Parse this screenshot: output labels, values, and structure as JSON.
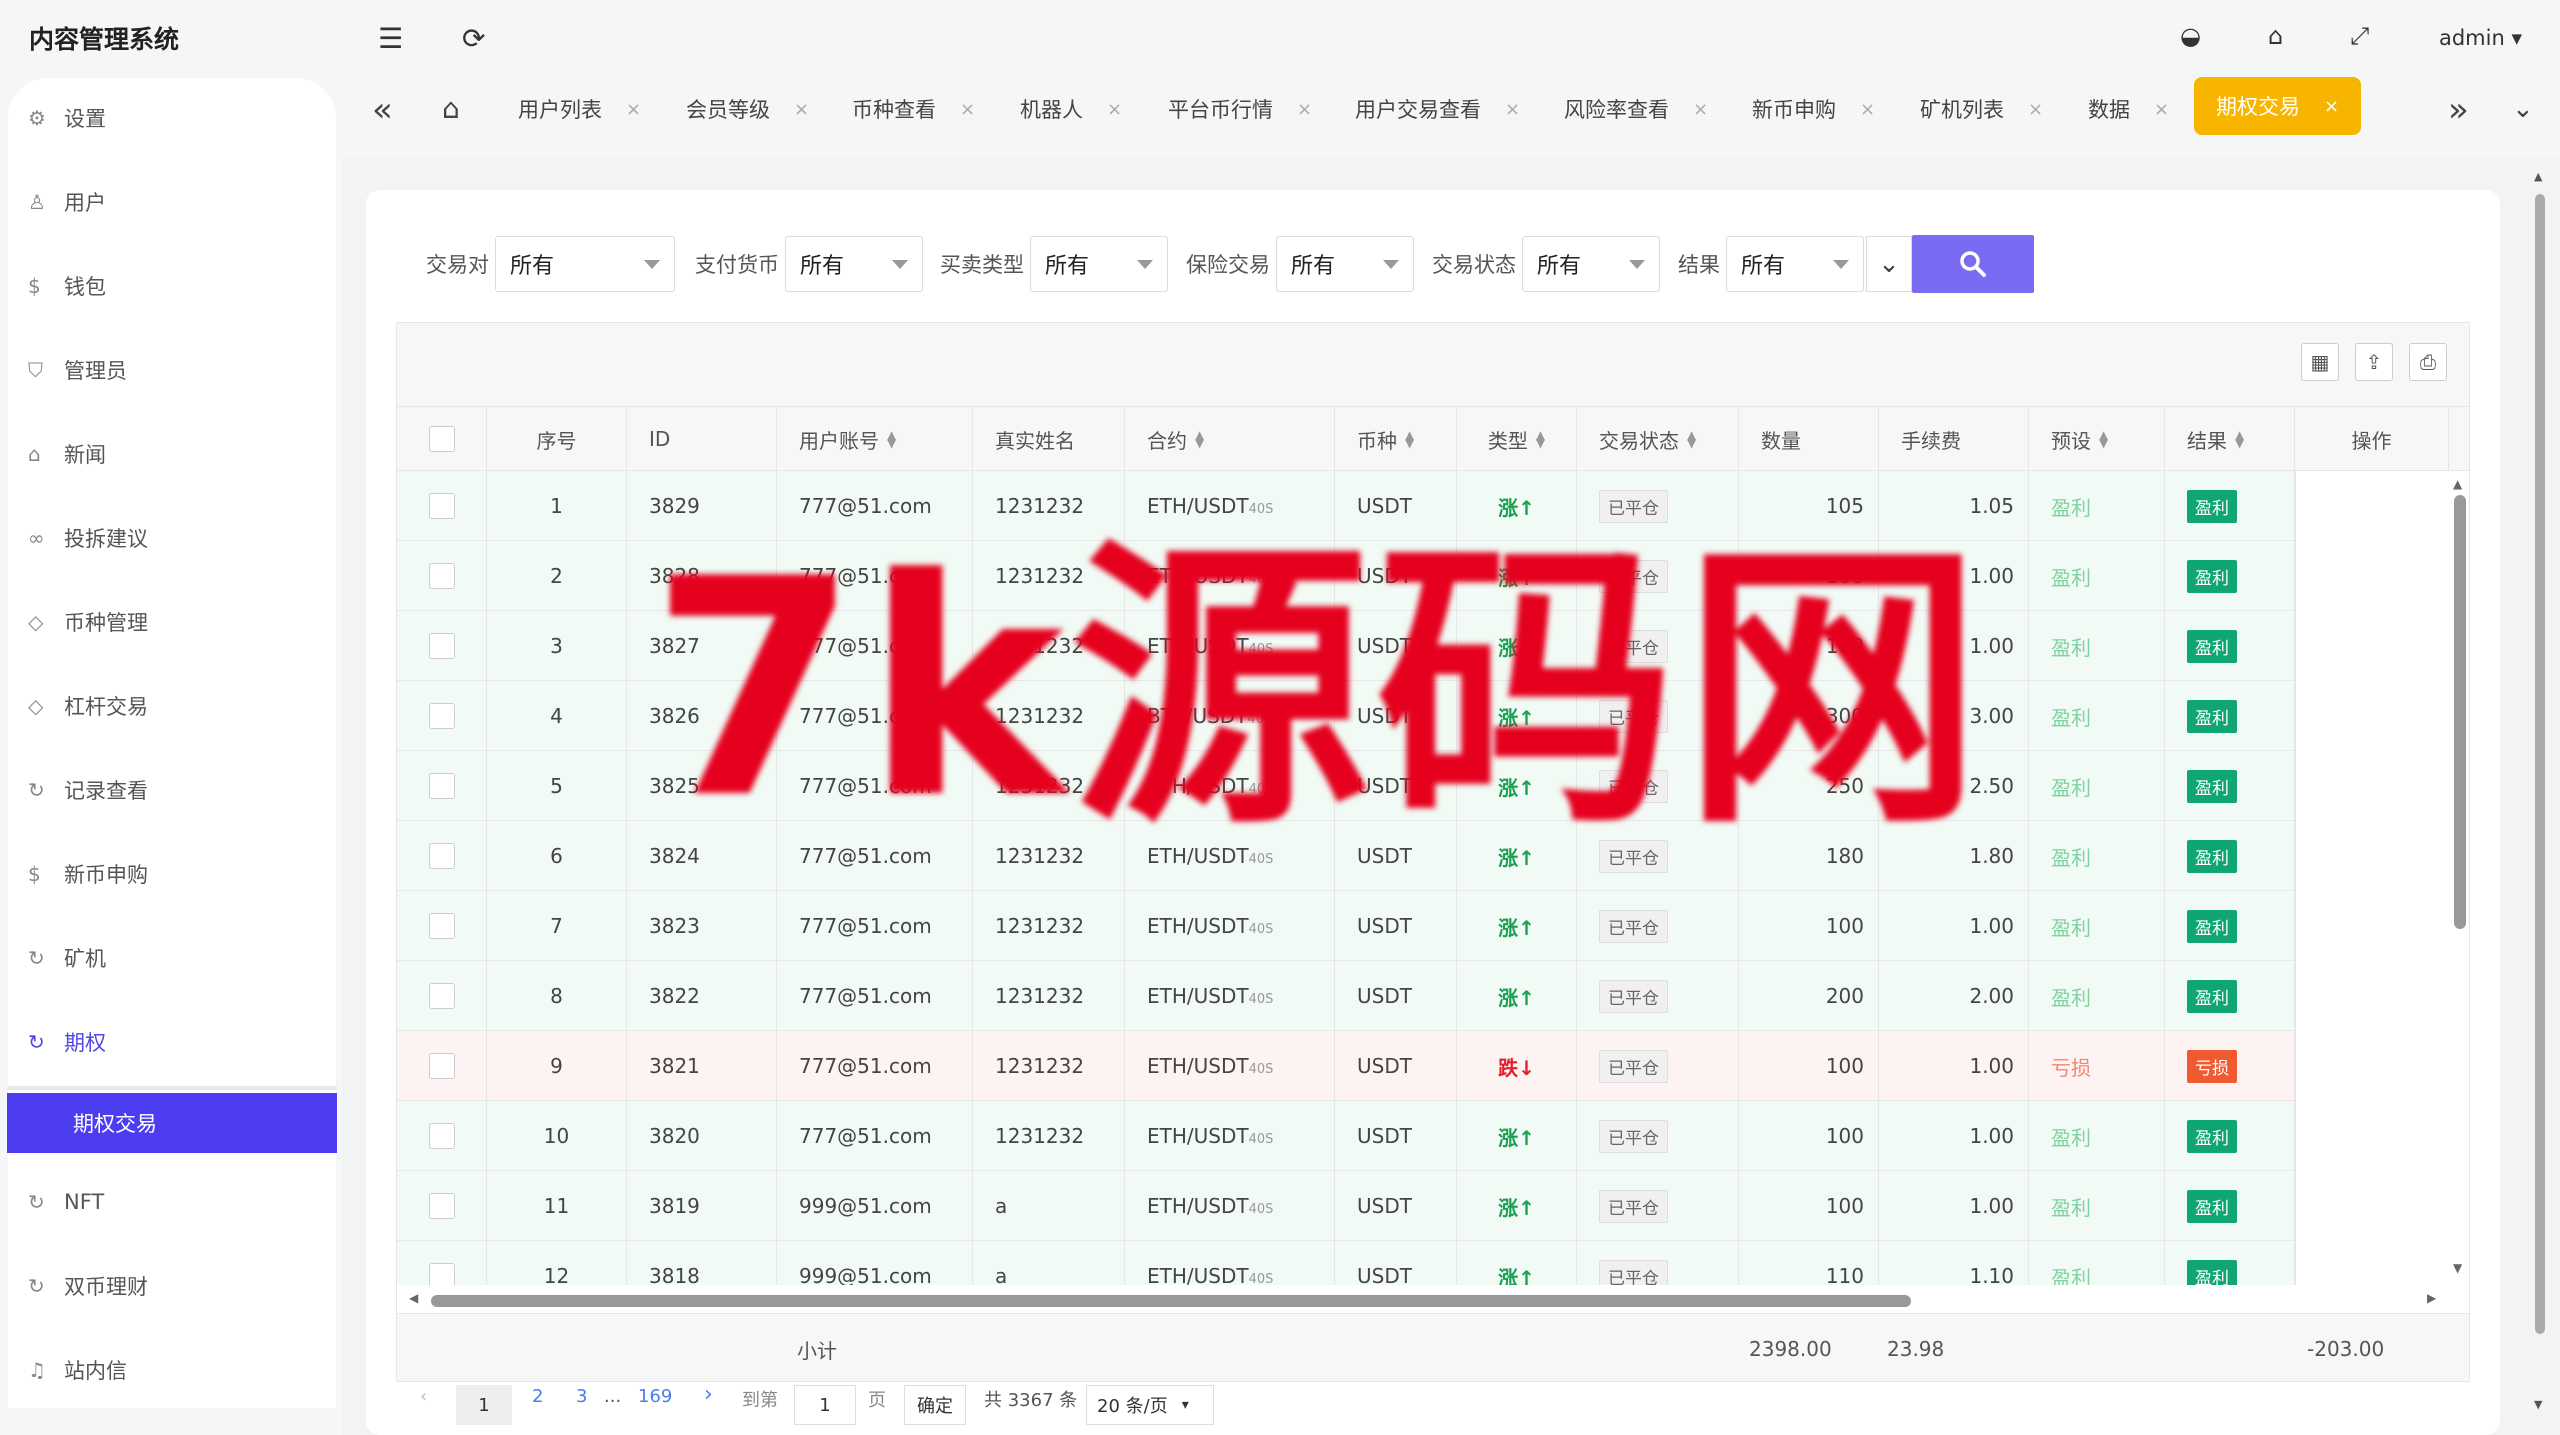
{
  "app": {
    "title": "内容管理系统",
    "user": "admin"
  },
  "sidebar": {
    "items": [
      {
        "label": "设置",
        "icon": "gear-icon"
      },
      {
        "label": "用户",
        "icon": "user-icon"
      },
      {
        "label": "钱包",
        "icon": "dollar-icon"
      },
      {
        "label": "管理员",
        "icon": "shield-icon"
      },
      {
        "label": "新闻",
        "icon": "tag-icon"
      },
      {
        "label": "投拆建议",
        "icon": "link-icon"
      },
      {
        "label": "币种管理",
        "icon": "diamond-icon"
      },
      {
        "label": "杠杆交易",
        "icon": "diamond-icon"
      },
      {
        "label": "记录查看",
        "icon": "circle-arrow-icon"
      },
      {
        "label": "新币申购",
        "icon": "dollar-icon"
      },
      {
        "label": "矿机",
        "icon": "circle-arrow-icon"
      },
      {
        "label": "期权",
        "icon": "circle-arrow-icon"
      },
      {
        "label": "NFT",
        "icon": "circle-arrow-icon"
      },
      {
        "label": "双币理财",
        "icon": "circle-arrow-icon"
      },
      {
        "label": "站内信",
        "icon": "bell-icon"
      }
    ],
    "active_sub": "期权交易"
  },
  "tabs": [
    "用户列表",
    "会员等级",
    "币种查看",
    "机器人",
    "平台币行情",
    "用户交易查看",
    "风险率查看",
    "新币申购",
    "矿机列表",
    "数据",
    "期权交易"
  ],
  "filters": [
    {
      "label": "交易对",
      "value": "所有"
    },
    {
      "label": "支付货币",
      "value": "所有"
    },
    {
      "label": "买卖类型",
      "value": "所有"
    },
    {
      "label": "保险交易",
      "value": "所有"
    },
    {
      "label": "交易状态",
      "value": "所有"
    },
    {
      "label": "结果",
      "value": "所有"
    }
  ],
  "table": {
    "headers": [
      "序号",
      "ID",
      "用户账号",
      "真实姓名",
      "合约",
      "币种",
      "类型",
      "交易状态",
      "数量",
      "手续费",
      "预设",
      "结果",
      "操作"
    ],
    "contract_suffix": "40S",
    "rows": [
      {
        "no": "1",
        "id": "3829",
        "account": "777@51.com",
        "name": "1231232",
        "contract": "ETH/USDT",
        "coin": "USDT",
        "type": "涨↑",
        "status": "已平仓",
        "qty": "105",
        "fee": "1.05",
        "preset": "盈利",
        "result": "盈利",
        "win": true
      },
      {
        "no": "2",
        "id": "3828",
        "account": "777@51.com",
        "name": "1231232",
        "contract": "ETH/USDT",
        "coin": "USDT",
        "type": "涨↑",
        "status": "已平仓",
        "qty": "100",
        "fee": "1.00",
        "preset": "盈利",
        "result": "盈利",
        "win": true
      },
      {
        "no": "3",
        "id": "3827",
        "account": "777@51.com",
        "name": "1231232",
        "contract": "ETH/USDT",
        "coin": "USDT",
        "type": "涨↑",
        "status": "已平仓",
        "qty": "100",
        "fee": "1.00",
        "preset": "盈利",
        "result": "盈利",
        "win": true
      },
      {
        "no": "4",
        "id": "3826",
        "account": "777@51.com",
        "name": "1231232",
        "contract": "BTC/USDT",
        "coin": "USDT",
        "type": "涨↑",
        "status": "已平仓",
        "qty": "300",
        "fee": "3.00",
        "preset": "盈利",
        "result": "盈利",
        "win": true
      },
      {
        "no": "5",
        "id": "3825",
        "account": "777@51.com",
        "name": "1231232",
        "contract": "ETH/USDT",
        "coin": "USDT",
        "type": "涨↑",
        "status": "已平仓",
        "qty": "250",
        "fee": "2.50",
        "preset": "盈利",
        "result": "盈利",
        "win": true
      },
      {
        "no": "6",
        "id": "3824",
        "account": "777@51.com",
        "name": "1231232",
        "contract": "ETH/USDT",
        "coin": "USDT",
        "type": "涨↑",
        "status": "已平仓",
        "qty": "180",
        "fee": "1.80",
        "preset": "盈利",
        "result": "盈利",
        "win": true
      },
      {
        "no": "7",
        "id": "3823",
        "account": "777@51.com",
        "name": "1231232",
        "contract": "ETH/USDT",
        "coin": "USDT",
        "type": "涨↑",
        "status": "已平仓",
        "qty": "100",
        "fee": "1.00",
        "preset": "盈利",
        "result": "盈利",
        "win": true
      },
      {
        "no": "8",
        "id": "3822",
        "account": "777@51.com",
        "name": "1231232",
        "contract": "ETH/USDT",
        "coin": "USDT",
        "type": "涨↑",
        "status": "已平仓",
        "qty": "200",
        "fee": "2.00",
        "preset": "盈利",
        "result": "盈利",
        "win": true
      },
      {
        "no": "9",
        "id": "3821",
        "account": "777@51.com",
        "name": "1231232",
        "contract": "ETH/USDT",
        "coin": "USDT",
        "type": "跌↓",
        "status": "已平仓",
        "qty": "100",
        "fee": "1.00",
        "preset": "亏损",
        "result": "亏损",
        "win": false
      },
      {
        "no": "10",
        "id": "3820",
        "account": "777@51.com",
        "name": "1231232",
        "contract": "ETH/USDT",
        "coin": "USDT",
        "type": "涨↑",
        "status": "已平仓",
        "qty": "100",
        "fee": "1.00",
        "preset": "盈利",
        "result": "盈利",
        "win": true
      },
      {
        "no": "11",
        "id": "3819",
        "account": "999@51.com",
        "name": "a",
        "contract": "ETH/USDT",
        "coin": "USDT",
        "type": "涨↑",
        "status": "已平仓",
        "qty": "100",
        "fee": "1.00",
        "preset": "盈利",
        "result": "盈利",
        "win": true
      },
      {
        "no": "12",
        "id": "3818",
        "account": "999@51.com",
        "name": "a",
        "contract": "ETH/USDT",
        "coin": "USDT",
        "type": "涨↑",
        "status": "已平仓",
        "qty": "110",
        "fee": "1.10",
        "preset": "盈利",
        "result": "盈利",
        "win": true
      }
    ],
    "footer": {
      "label": "小计",
      "qty_total": "2398.00",
      "fee_total": "23.98",
      "result_total": "-203.00"
    }
  },
  "pagination": {
    "pages": [
      "1",
      "2",
      "3",
      "...",
      "169"
    ],
    "goto_label": "到第",
    "goto_value": "1",
    "page_unit": "页",
    "confirm": "确定",
    "total": "共 3367 条",
    "per_page": "20 条/页"
  },
  "watermark": "7k源码网",
  "colors": {
    "accent": "#4d3df0",
    "active_tab": "#f8b500",
    "win_badge": "#10a574",
    "lose_badge": "#f05a30",
    "up": "#1aa050",
    "down": "#e0202a"
  }
}
